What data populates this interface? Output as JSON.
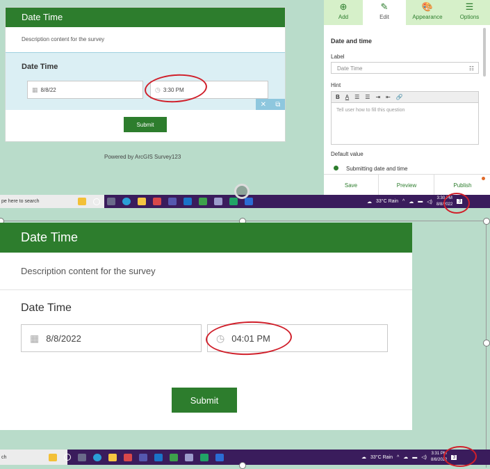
{
  "top_form": {
    "header": "Date Time",
    "description": "Description content for the survey",
    "question": "Date Time",
    "date_value": "8/8/22",
    "time_value": "3:30 PM",
    "submit": "Submit",
    "powered_by": "Powered by ArcGIS Survey123"
  },
  "panel": {
    "toolbar": [
      {
        "label": "Add",
        "icon": "plus-circle-icon",
        "glyph": "⊕"
      },
      {
        "label": "Edit",
        "icon": "pencil-icon",
        "glyph": "✎"
      },
      {
        "label": "Appearance",
        "icon": "palette-icon",
        "glyph": "🎨"
      },
      {
        "label": "Options",
        "icon": "sliders-icon",
        "glyph": "☰"
      }
    ],
    "section_title": "Date and time",
    "label_title": "Label",
    "label_value": "Date Time",
    "hint_title": "Hint",
    "hint_placeholder": "Tell user how to fill this question",
    "default_title": "Default value",
    "default_option": "Submitting date and time",
    "bottom": {
      "save": "Save",
      "preview": "Preview",
      "publish": "Publish"
    }
  },
  "taskbar_top": {
    "search": "pe here to search",
    "weather": "33°C  Rain",
    "time": "3:30 PM",
    "date": "8/8/2022",
    "notifications": "3"
  },
  "big_form": {
    "header": "Date Time",
    "description": "Description content for the survey",
    "question": "Date Time",
    "date_value": "8/8/2022",
    "time_value": "04:01 PM",
    "submit": "Submit"
  },
  "taskbar_bottom": {
    "search": "ch",
    "weather": "33°C  Rain",
    "time": "3:31 PM",
    "date": "8/8/2022",
    "notifications": "3"
  },
  "colors": {
    "brand_green": "#2d7d2d",
    "taskbar": "#3a1c5c",
    "annotation_red": "#d01f2a"
  }
}
